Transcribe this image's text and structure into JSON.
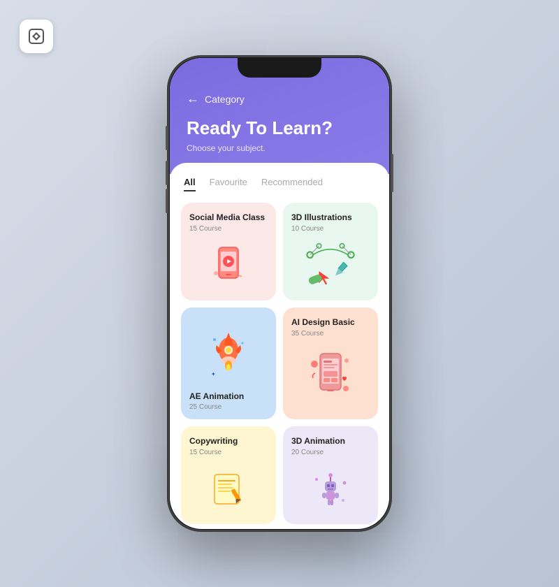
{
  "logo": {
    "alt": "App Logo"
  },
  "header": {
    "nav_back": "←",
    "nav_title": "Category",
    "title": "Ready To Learn?",
    "subtitle": "Choose your subject."
  },
  "tabs": [
    {
      "label": "All",
      "active": true
    },
    {
      "label": "Favourite",
      "active": false
    },
    {
      "label": "Recommended",
      "active": false
    }
  ],
  "cards": [
    {
      "title": "Social Media Class",
      "subtitle": "15 Course",
      "color": "pink",
      "emoji": "📱"
    },
    {
      "title": "3D Illustrations",
      "subtitle": "10 Course",
      "color": "mint",
      "emoji": "🖊️"
    },
    {
      "title": "AE Animation",
      "subtitle": "25 Course",
      "color": "blue",
      "emoji": "🚀"
    },
    {
      "title": "AI Design Basic",
      "subtitle": "35 Course",
      "color": "salmon",
      "emoji": "📲"
    },
    {
      "title": "Copywriting",
      "subtitle": "15 Course",
      "color": "yellow",
      "emoji": "✏️"
    },
    {
      "title": "3D Animation",
      "subtitle": "20 Course",
      "color": "lavender",
      "emoji": "🤖"
    }
  ]
}
